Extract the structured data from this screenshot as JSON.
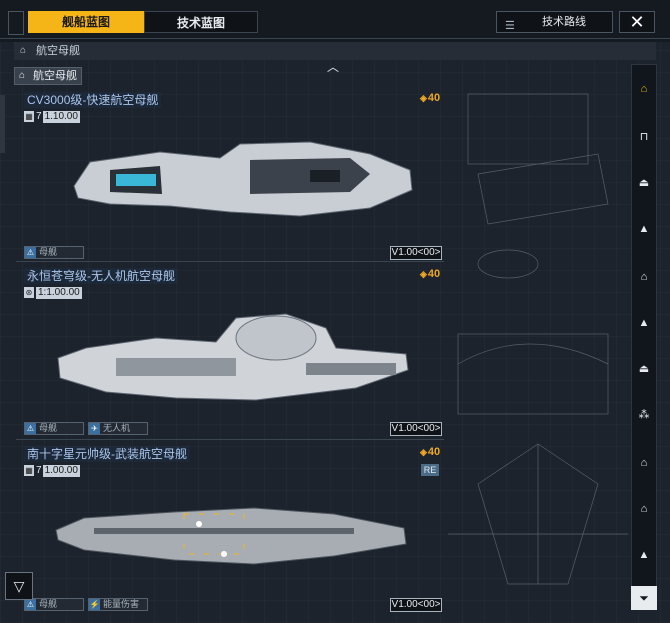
{
  "tabs": {
    "ship_blueprint": "舰船蓝图",
    "tech_blueprint": "技术蓝图"
  },
  "route_button": "技术路线",
  "breadcrumb": "航空母舰",
  "category_tag": "航空母舰",
  "ships": [
    {
      "name": "CV3000级-快速航空母舰",
      "ratio_prefix": "7",
      "ratio": "1.10.00",
      "cost": "40",
      "tags": [
        "母舰"
      ],
      "version": "V1.00<00>"
    },
    {
      "name": "永恒苍穹级-无人机航空母舰",
      "ratio_prefix": "",
      "ratio": "1:1.00.00",
      "cost": "40",
      "tags": [
        "母舰",
        "无人机"
      ],
      "version": "V1.00<00>"
    },
    {
      "name": "南十字星元帅级-武装航空母舰",
      "ratio_prefix": "7",
      "ratio": "1.00.00",
      "cost": "40",
      "badge": "RE",
      "tags": [
        "母舰",
        "能量伤害"
      ],
      "version": "V1.00<00>"
    }
  ],
  "colors": {
    "accent": "#f5b516",
    "cost": "#f0a826",
    "ship_name": "#a9c6ec"
  },
  "icons": [
    "close-icon",
    "route-icon",
    "carrier-icon",
    "cost-icon",
    "filter-icon",
    "up-chevron-icon"
  ]
}
